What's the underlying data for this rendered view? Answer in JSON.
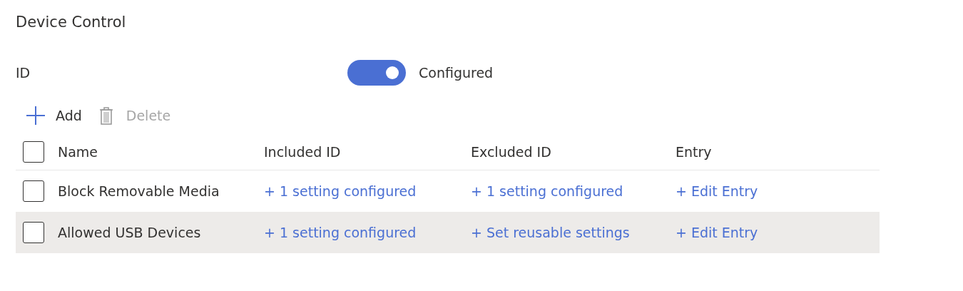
{
  "title": "Device Control",
  "id_setting": {
    "label": "ID",
    "on": true,
    "state_label": "Configured"
  },
  "toolbar": [
    {
      "kind": "add",
      "label": "Add",
      "disabled": false
    },
    {
      "kind": "delete",
      "label": "Delete",
      "disabled": true
    }
  ],
  "table": {
    "select_all_checked": false,
    "columns": [
      "Name",
      "Included ID",
      "Excluded ID",
      "Entry"
    ],
    "rows": [
      {
        "selected": false,
        "checked": false,
        "name": "Block Removable Media",
        "included": "+ 1 setting configured",
        "excluded": "+ 1 setting configured",
        "entry": "+ Edit Entry"
      },
      {
        "selected": true,
        "checked": false,
        "name": "Allowed USB Devices",
        "included": "+ 1 setting configured",
        "excluded": "+ Set reusable settings",
        "entry": "+ Edit Entry"
      }
    ]
  }
}
